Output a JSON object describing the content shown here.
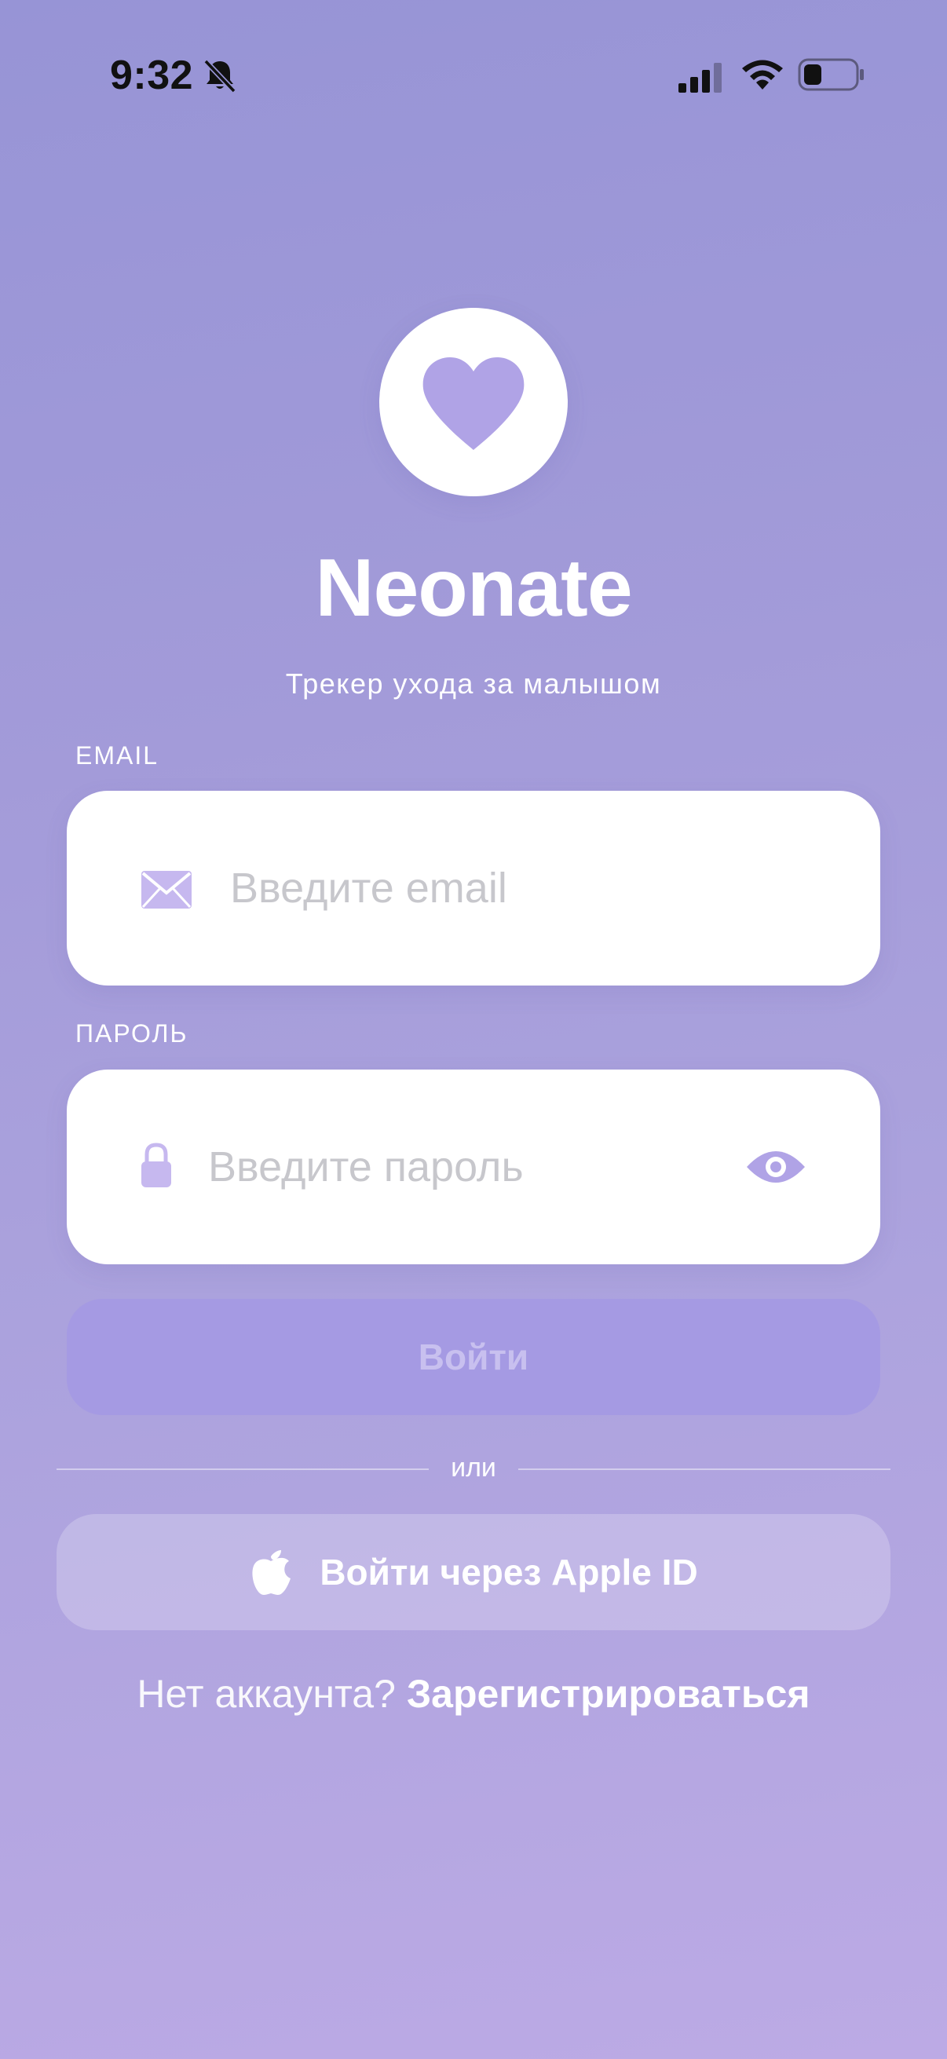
{
  "status_bar": {
    "time": "9:32",
    "icons": [
      "bell-slash-icon",
      "cellular-signal-icon",
      "wifi-icon",
      "battery-icon"
    ]
  },
  "logo": {
    "icon": "heart-icon"
  },
  "app": {
    "title": "Neonate",
    "subtitle": "Трекер ухода за малышом"
  },
  "form": {
    "email": {
      "label": "EMAIL",
      "placeholder": "Введите email",
      "value": "",
      "icon": "mail-icon"
    },
    "password": {
      "label": "ПАРОЛЬ",
      "placeholder": "Введите пароль",
      "value": "",
      "icon": "lock-icon",
      "toggle_icon": "eye-icon"
    },
    "login_label": "Войти"
  },
  "divider": {
    "text": "или"
  },
  "apple_signin": {
    "label": "Войти через Apple ID",
    "icon": "apple-icon"
  },
  "register": {
    "prompt": "Нет аккаунта?",
    "link": "Зарегистрироваться"
  },
  "colors": {
    "background_top": "#9794d6",
    "background_bottom": "#bcaae5",
    "accent": "#b0a3e6",
    "button_disabled": "#a59ae3"
  }
}
